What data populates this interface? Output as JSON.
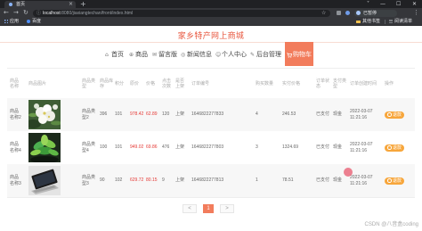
{
  "browser": {
    "tab_title": "首页",
    "url_host": "localhost",
    "url_path": ":8080/jiaxiangtechan/front/index.html",
    "profile_label": "已暂停",
    "bookmarks": [
      "应用",
      "百度"
    ],
    "bookmarks_right": [
      "其他书签",
      "阅读清单"
    ],
    "icons": [
      "back-icon",
      "forward-icon",
      "reload-icon",
      "info-icon",
      "bookmark-star-icon",
      "menu-icon"
    ]
  },
  "site_title": "家乡特产网上商城",
  "nav": [
    {
      "label": "首页",
      "icon": "home-icon"
    },
    {
      "label": "商品",
      "icon": "goods-icon"
    },
    {
      "label": "留言版",
      "icon": "message-icon"
    },
    {
      "label": "新闻信息",
      "icon": "news-icon"
    },
    {
      "label": "个人中心",
      "icon": "user-icon"
    },
    {
      "label": "后台管理",
      "icon": "admin-icon"
    },
    {
      "label": "购物车",
      "icon": "cart-icon",
      "active": true
    }
  ],
  "table": {
    "headers": [
      "商品名称",
      "商品图片",
      "商品类型",
      "商品库存",
      "积分",
      "原价",
      "价格",
      "点击次数",
      "是否上架",
      "订单编号",
      "购买数量",
      "实付价格",
      "订单状态",
      "支付类型",
      "订单创建时间",
      "操作"
    ],
    "rows": [
      {
        "name": "商品名称2",
        "type": "商品类型2",
        "stock": "396",
        "points": "101",
        "price_a": "978.42",
        "price_b": "62.89",
        "clicks": "120",
        "shelf": "上架",
        "order_no": "1646822277833",
        "quantity": "4",
        "paid": "246.53",
        "status": "已支付",
        "pay_type": "现金",
        "created": "2022-03-07 11:21:16",
        "action": "退款"
      },
      {
        "name": "商品名称4",
        "type": "商品类型4",
        "stock": "100",
        "points": "101",
        "price_a": "949.02",
        "price_b": "69.86",
        "clicks": "476",
        "shelf": "上架",
        "order_no": "1646822277803",
        "quantity": "3",
        "paid": "1324.69",
        "status": "已支付",
        "pay_type": "现金",
        "created": "2022-03-07 11:21:16",
        "action": "退款"
      },
      {
        "name": "商品名称3",
        "type": "商品类型3",
        "stock": "90",
        "points": "102",
        "price_a": "629.72",
        "price_b": "80.15",
        "clicks": "9",
        "shelf": "上架",
        "order_no": "1646822277813",
        "quantity": "1",
        "paid": "78.51",
        "status": "已支付",
        "pay_type": "现金",
        "created": "2022-03-07 11:21:16",
        "action": "退款"
      }
    ]
  },
  "pagination": {
    "prev": "<",
    "current": "1",
    "next": ">"
  },
  "watermark": "CSDN @八音盒coding",
  "colors": {
    "accent": "#f27c5c",
    "title": "#e8573f",
    "price": "#e53935",
    "action_button": "#f7a63b",
    "browser_chrome": "#35363a"
  }
}
